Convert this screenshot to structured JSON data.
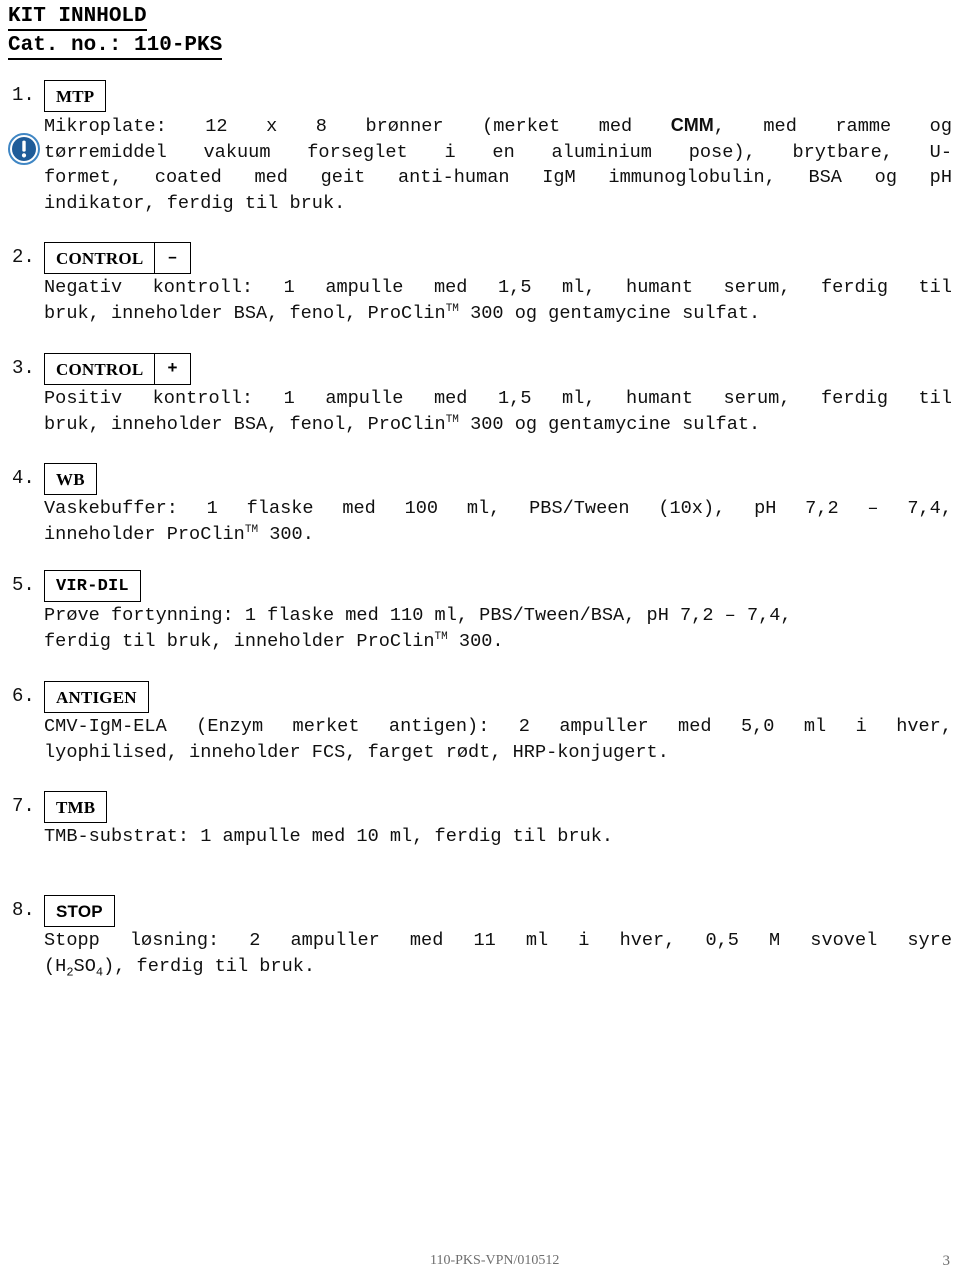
{
  "document": {
    "title_line_1": "KIT INNHOLD",
    "title_line_2": "Cat. no.: 110-PKS"
  },
  "icons": {
    "warning": "exclamation-circle-icon",
    "warning_color": "#1f5c99",
    "warning_ring_color": "#2d7ab8"
  },
  "items": [
    {
      "number": "1.",
      "tag_main": "MTP",
      "tag_sign": "",
      "line_1": "Mikroplate:  12  x  8  brønner  (merket  med  ",
      "bold_token": "CMM",
      "line_1b": ",  med  ramme  og",
      "line_2": "tørremiddel  vakuum  forseglet  i  en  aluminium  pose),  brytbare,  U-",
      "line_3": "formet,  coated  med  geit  anti-human  IgM  immunoglobulin,  BSA  og  pH",
      "line_4": "indikator, ferdig til bruk."
    },
    {
      "number": "2.",
      "tag_main": "CONTROL",
      "tag_sign": "–",
      "line_1": "Negativ  kontroll:  1  ampulle  med  1,5  ml,  humant  serum,  ferdig  til",
      "line_2_a": "bruk, inneholder BSA, fenol, ProClin",
      "line_2_tm": "TM",
      "line_2_b": " 300 og gentamycine sulfat."
    },
    {
      "number": "3.",
      "tag_main": "CONTROL",
      "tag_sign": "+",
      "line_1": "Positiv  kontroll:  1  ampulle  med  1,5  ml,  humant  serum,  ferdig  til",
      "line_2_a": "bruk, inneholder BSA, fenol, ProClin",
      "line_2_tm": "TM",
      "line_2_b": " 300 og gentamycine sulfat."
    },
    {
      "number": "4.",
      "tag_main": "WB",
      "tag_sign": "",
      "line_1": "Vaskebuffer:  1  flaske  med  100  ml,  PBS/Tween  (10x),  pH  7,2  –  7,4,",
      "line_2_a": "inneholder ProClin",
      "line_2_tm": "TM",
      "line_2_b": " 300."
    },
    {
      "number": "5.",
      "tag_main": "VIR-DIL",
      "tag_sign": "",
      "line_1": "Prøve fortynning: 1 flaske med 110 ml, PBS/Tween/BSA, pH 7,2 – 7,4,",
      "line_2_a": "ferdig til bruk, inneholder ProClin",
      "line_2_tm": "TM",
      "line_2_b": " 300."
    },
    {
      "number": "6.",
      "tag_main": "ANTIGEN",
      "tag_sign": "",
      "line_1": "CMV-IgM-ELA  (Enzym  merket  antigen):  2  ampuller  med  5,0  ml  i  hver,",
      "line_2": "lyophilised, inneholder FCS, farget rødt, HRP-konjugert."
    },
    {
      "number": "7.",
      "tag_main": "TMB",
      "tag_sign": "",
      "line_1": "TMB-substrat: 1 ampulle med 10 ml, ferdig til bruk."
    },
    {
      "number": "8.",
      "tag_main": "STOP",
      "tag_sign": "",
      "line_1": "Stopp  løsning:  2  ampuller  med  11  ml  i  hver,  0,5  M  svovel  syre",
      "line_2_a": "(H",
      "line_2_sub1": "2",
      "line_2_mid": "SO",
      "line_2_sub2": "4",
      "line_2_b": "), ferdig til bruk."
    }
  ],
  "footer": {
    "code": "110-PKS-VPN/010512",
    "page_number": "3"
  }
}
